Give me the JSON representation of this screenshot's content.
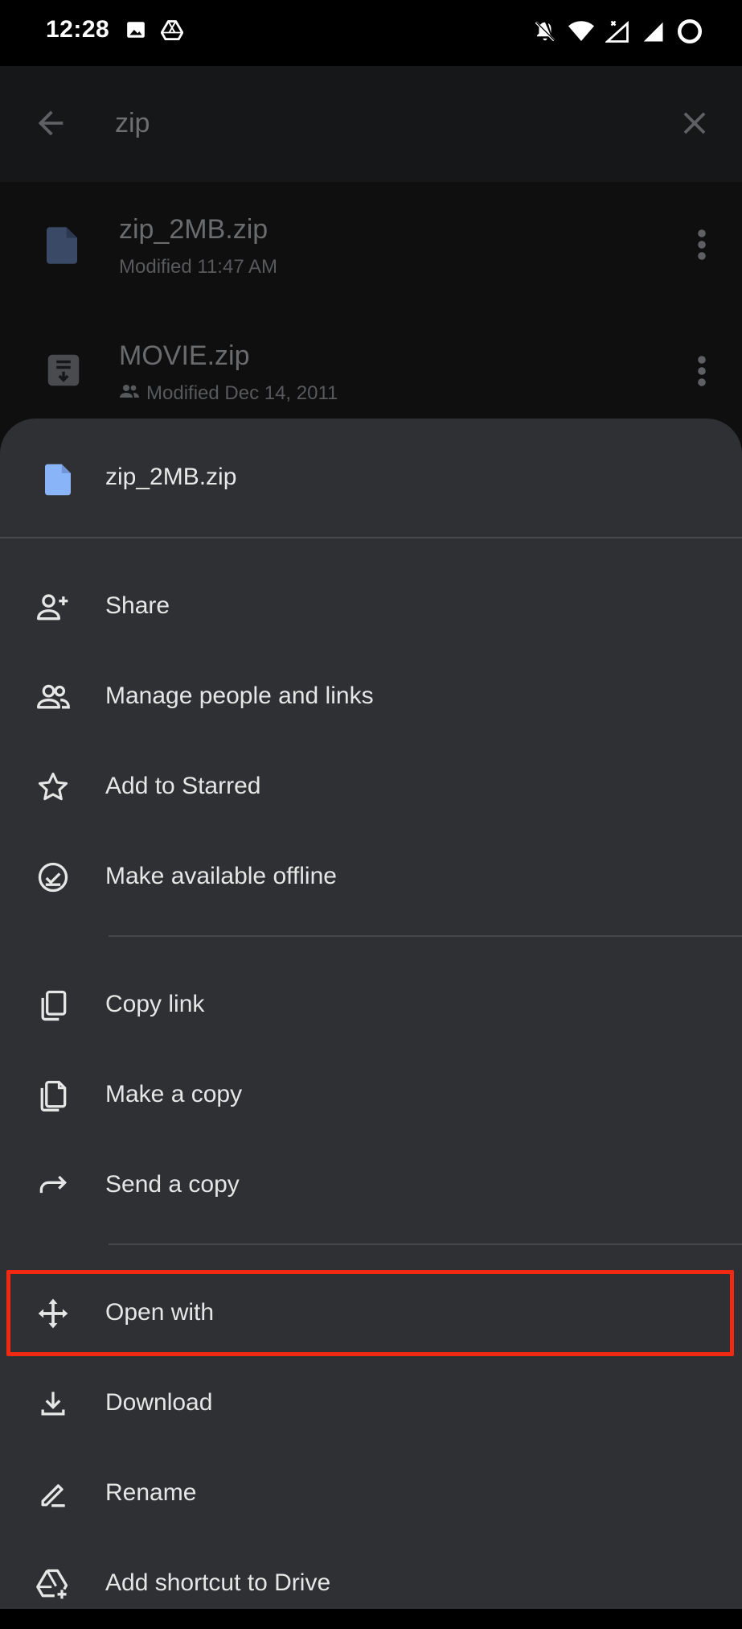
{
  "status_bar": {
    "time": "12:28",
    "left_icons": [
      "image-icon",
      "drive-icon"
    ],
    "right_icons": [
      "notifications-off-icon",
      "wifi-icon",
      "signal-x-icon",
      "signal-icon",
      "battery-ring-icon"
    ]
  },
  "search": {
    "query": "zip"
  },
  "files": [
    {
      "name": "zip_2MB.zip",
      "meta": "Modified 11:47 AM",
      "icon": "file-icon",
      "shared": false
    },
    {
      "name": "MOVIE.zip",
      "meta": "Modified Dec 14, 2011",
      "icon": "archive-icon",
      "shared": true
    }
  ],
  "sheet": {
    "title": "zip_2MB.zip",
    "items": [
      {
        "label": "Share",
        "icon": "person-add-icon"
      },
      {
        "label": "Manage people and links",
        "icon": "people-icon"
      },
      {
        "label": "Add to Starred",
        "icon": "star-icon"
      },
      {
        "label": "Make available offline",
        "icon": "offline-check-icon"
      },
      {
        "label": "Copy link",
        "icon": "copy-link-icon"
      },
      {
        "label": "Make a copy",
        "icon": "file-copy-icon"
      },
      {
        "label": "Send a copy",
        "icon": "forward-icon"
      },
      {
        "label": "Open with",
        "icon": "open-with-icon"
      },
      {
        "label": "Download",
        "icon": "download-icon"
      },
      {
        "label": "Rename",
        "icon": "rename-icon"
      },
      {
        "label": "Add shortcut to Drive",
        "icon": "add-to-drive-icon"
      }
    ]
  },
  "colors": {
    "sheet_bg": "#2f3034",
    "highlight": "#f02a12",
    "file_icon_blue": "#8ab4f8"
  }
}
